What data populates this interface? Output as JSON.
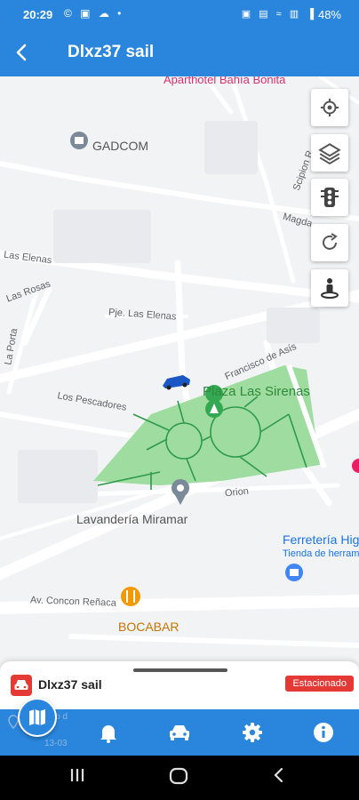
{
  "status_bar": {
    "time": "20:29",
    "left_icons": "© ▣ ☁ •",
    "right_icons": "▣ ▤ ≈ ▥ ▐",
    "battery": "48%"
  },
  "appbar": {
    "back_icon": "arrow-left-icon",
    "title": "Dlxz37 sail"
  },
  "map": {
    "places": {
      "aparthotel": "Aparthotel Bahía Bonita",
      "gadcom": "GADCOM",
      "plaza": "Plaza Las Sirenas",
      "lavanderia": "Lavandería Miramar",
      "ferreteria": "Ferretería Hig",
      "ferreteria_sub": "Tienda de herram",
      "bocabar": "BOCABAR"
    },
    "streets": {
      "las_elenas": "Las Elenas",
      "las_rosas": "Las Rosas",
      "la_porta": "La Porta",
      "pje_las_elenas": "Pje. Las Elenas",
      "los_pescadores": "Los Pescadores",
      "francisco_de_asis": "Francisco de Asís",
      "orion": "Orion",
      "av_concon": "Av. Concon Reñaca",
      "scipion": "Scipion R",
      "magdalena": "Magda"
    },
    "controls": [
      "my-location-icon",
      "layers-icon",
      "traffic-light-icon",
      "refresh-icon",
      "street-view-icon"
    ]
  },
  "vehicle_sheet": {
    "name": "Dlxz37 sail",
    "status": "Estacionado",
    "peek_line1": "isco d",
    "peek_line2": "13-03"
  },
  "bottom_nav": {
    "items": [
      "map-icon",
      "bell-icon",
      "car-icon",
      "gear-icon",
      "info-icon"
    ]
  },
  "colors": {
    "primary": "#2a86dc",
    "park": "#9fdc9f",
    "status_red": "#e53935"
  }
}
